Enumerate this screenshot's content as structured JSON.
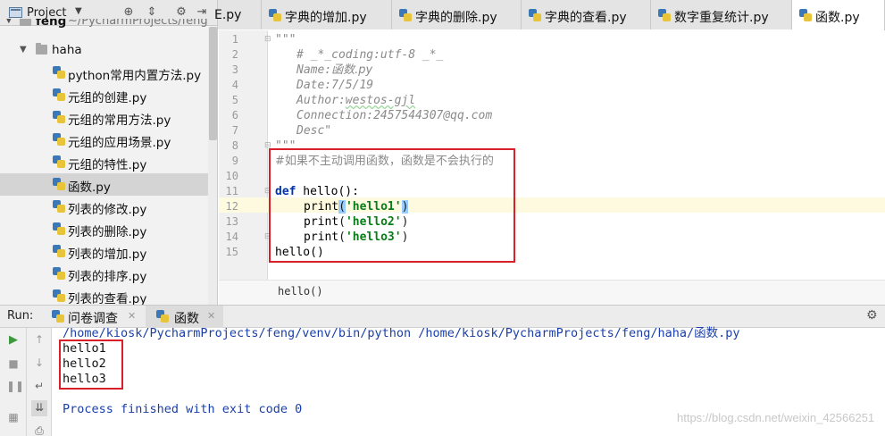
{
  "project_panel": {
    "title": "Project",
    "root": {
      "name": "feng",
      "path": "~/PycharmProjects/feng"
    },
    "folder": "haha",
    "files": [
      "python常用内置方法.py",
      "元组的创建.py",
      "元组的常用方法.py",
      "元组的应用场景.py",
      "元组的特性.py",
      "函数.py",
      "列表的修改.py",
      "列表的删除.py",
      "列表的增加.py",
      "列表的排序.py",
      "列表的查看.py"
    ],
    "selected_file": "函数.py"
  },
  "tabs": [
    {
      "label": "E.py",
      "active": false
    },
    {
      "label": "字典的增加.py",
      "active": false
    },
    {
      "label": "字典的删除.py",
      "active": false
    },
    {
      "label": "字典的查看.py",
      "active": false
    },
    {
      "label": "数字重复统计.py",
      "active": false
    },
    {
      "label": "函数.py",
      "active": true
    }
  ],
  "editor": {
    "line_numbers": [
      "1",
      "2",
      "3",
      "4",
      "5",
      "6",
      "7",
      "8",
      "9",
      "10",
      "11",
      "12",
      "13",
      "14",
      "15"
    ],
    "docstring_open": "\"\"\"",
    "header": {
      "coding": "# _*_coding:utf-8 _*_",
      "name_label": "Name:",
      "name_value": "函数.py",
      "date": "Date:7/5/19",
      "author_label": "Author:",
      "author_value": "westos-gjl",
      "connection": "Connection:2457544307@qq.com",
      "desc": "Desc\""
    },
    "docstring_close": "\"\"\"",
    "comment": "#如果不主动调用函数，函数是不会执行的",
    "def_keyword": "def",
    "def_rest": " hello():",
    "print_calls": [
      {
        "fn": "print",
        "open": "(",
        "arg": "'hello1'",
        "close": ")"
      },
      {
        "fn": "print",
        "open": "(",
        "arg": "'hello2'",
        "close": ")"
      },
      {
        "fn": "print",
        "open": "(",
        "arg": "'hello3'",
        "close": ")"
      }
    ],
    "call": "hello()",
    "breadcrumb": "hello()"
  },
  "run_panel": {
    "label": "Run:",
    "tabs": [
      {
        "label": "问卷调查",
        "active": false
      },
      {
        "label": "函数",
        "active": true
      }
    ],
    "output": {
      "command": "/home/kiosk/PycharmProjects/feng/venv/bin/python /home/kiosk/PycharmProjects/feng/haha/函数.py",
      "lines": [
        "hello1",
        "hello2",
        "hello3"
      ],
      "exit": "Process finished with exit code 0"
    }
  },
  "watermark": "https://blog.csdn.net/weixin_42566251",
  "colors": {
    "highlight_box": "#d9202a",
    "keyword": "#0033b3",
    "string": "#067d17",
    "comment": "#8a8a8a"
  }
}
